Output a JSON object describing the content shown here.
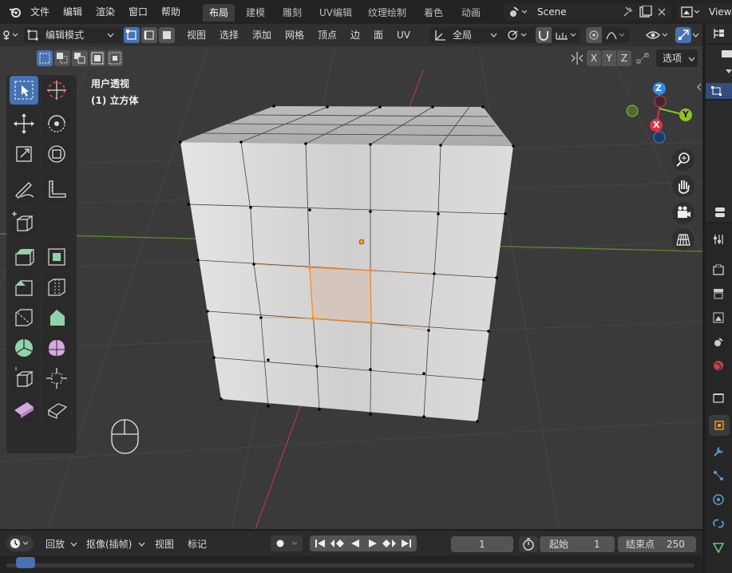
{
  "topbar": {
    "menus": [
      "文件",
      "编辑",
      "渲染",
      "窗口",
      "帮助"
    ],
    "workspaces": [
      "布局",
      "建模",
      "雕刻",
      "UV编辑",
      "纹理绘制",
      "着色",
      "动画"
    ],
    "active_workspace": "布局",
    "scene_name": "Scene",
    "view_layer": "View"
  },
  "header": {
    "mode": "编辑模式",
    "menus": [
      "视图",
      "选择",
      "添加",
      "网格",
      "顶点",
      "边",
      "面",
      "UV"
    ],
    "transform_orientation": "全局",
    "options_label": "选项",
    "axes": [
      "X",
      "Y",
      "Z"
    ]
  },
  "viewport": {
    "view_name": "用户透视",
    "object_label": "(1) 立方体",
    "gizmo_axes": [
      "Z",
      "Y",
      "X"
    ]
  },
  "timeline": {
    "playback": "回放",
    "keying": "抠像(插帧)",
    "view": "视图",
    "marker": "标记",
    "current_frame": "1",
    "start_label": "起始",
    "start_value": "1",
    "end_label": "结束点",
    "end_value": "250"
  },
  "colors": {
    "accent": "#4772b3",
    "selection": "#ff8c1a",
    "axis_x": "#e2304a",
    "axis_y": "#8bc424",
    "axis_z": "#2e8ae6"
  }
}
